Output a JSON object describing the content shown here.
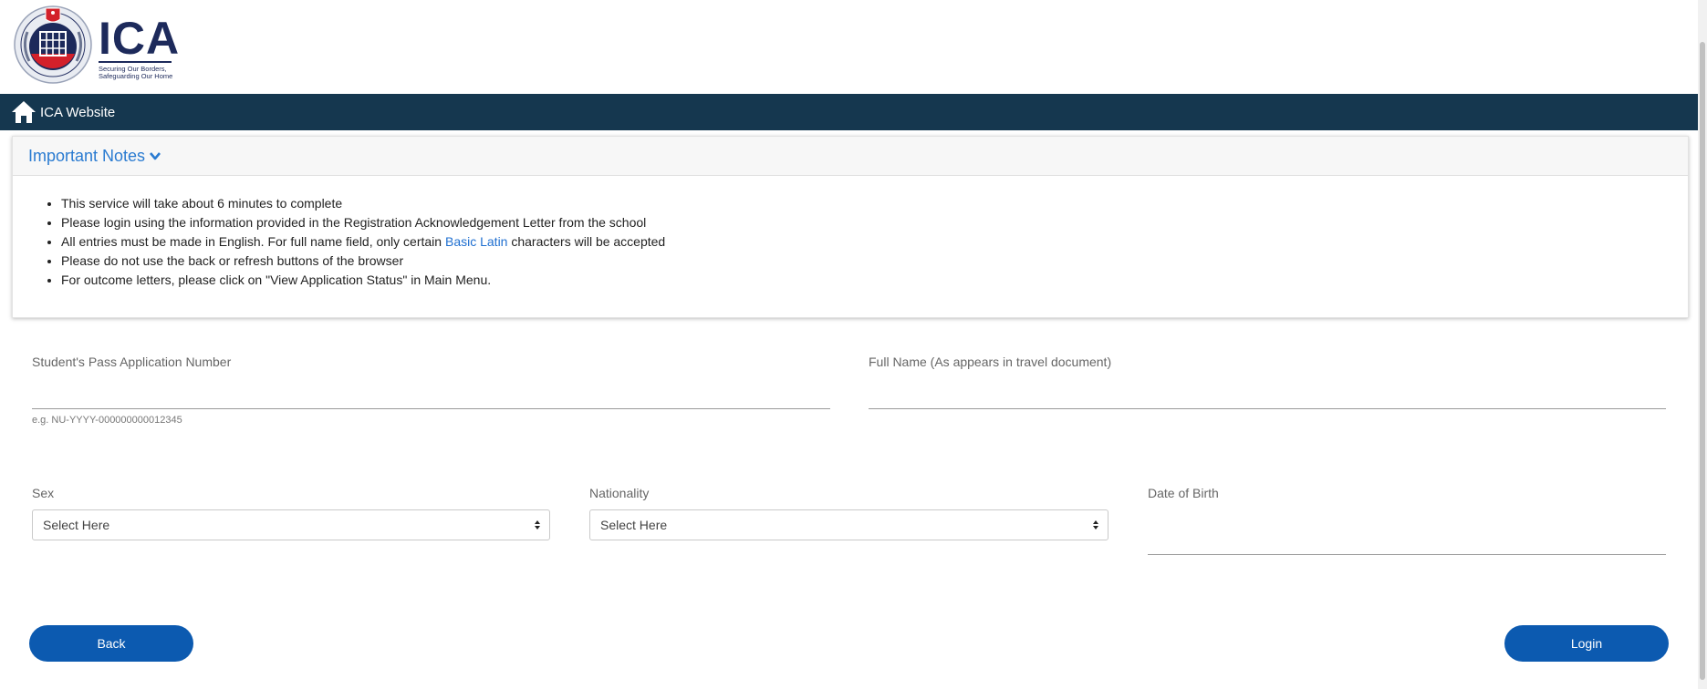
{
  "header": {
    "brand_name": "ICA",
    "tagline_line1": "Securing Our Borders,",
    "tagline_line2": "Safeguarding Our Home",
    "brand_color": "#1d2a5b"
  },
  "navbar": {
    "home_label": "ICA Website",
    "home_icon": "home-icon",
    "background": "#15374f"
  },
  "notes": {
    "title": "Important Notes",
    "items": [
      "This service will take about 6 minutes to complete",
      "Please login using the information provided in the Registration Acknowledgement Letter from the school",
      "Please do not use the back or refresh buttons of the browser",
      "For outcome letters, please click on \"View Application Status\" in Main Menu."
    ],
    "latin_item_prefix": "All entries must be made in English. For full name field, only certain ",
    "latin_item_link": "Basic Latin",
    "latin_item_suffix": " characters will be accepted"
  },
  "form": {
    "spa_label": "Student's Pass Application Number",
    "spa_value": "",
    "spa_hint": "e.g. NU-YYYY-000000000012345",
    "name_label": "Full Name (As appears in travel document)",
    "name_value": "",
    "sex_label": "Sex",
    "sex_selected": "Select Here",
    "nationality_label": "Nationality",
    "nationality_selected": "Select Here",
    "dob_label": "Date of Birth",
    "dob_value": ""
  },
  "buttons": {
    "back_label": "Back",
    "login_label": "Login",
    "color": "#0c5ab0"
  }
}
